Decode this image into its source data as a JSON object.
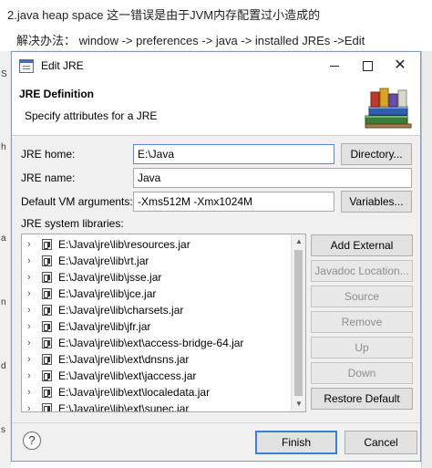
{
  "article": {
    "line1": "2.java heap space 这一错误是由于JVM内存配置过小造成的",
    "line2": "解决办法： window -> preferences -> java -> installed JREs ->Edit"
  },
  "background_strips": {
    "left_labels": [
      "S",
      "h",
      "a",
      "n",
      "d",
      "s"
    ]
  },
  "dialog": {
    "title": "Edit JRE",
    "header": {
      "title": "JRE Definition",
      "subtitle": "Specify attributes for a JRE"
    },
    "fields": {
      "jre_home_label": "JRE home:",
      "jre_home_value": "E:\\Java",
      "jre_name_label": "JRE name:",
      "jre_name_value": "Java",
      "vm_args_label": "Default VM arguments:",
      "vm_args_value": "-Xms512M -Xmx1024M",
      "libs_label": "JRE system libraries:"
    },
    "buttons": {
      "directory": "Directory...",
      "variables": "Variables...",
      "add_external_jars": "Add External JARs...",
      "javadoc_location": "Javadoc Location...",
      "source_attachment": "Source Attachment...",
      "remove": "Remove",
      "up": "Up",
      "down": "Down",
      "restore_default": "Restore Default",
      "finish": "Finish",
      "cancel": "Cancel"
    },
    "libraries": [
      "E:\\Java\\jre\\lib\\resources.jar",
      "E:\\Java\\jre\\lib\\rt.jar",
      "E:\\Java\\jre\\lib\\jsse.jar",
      "E:\\Java\\jre\\lib\\jce.jar",
      "E:\\Java\\jre\\lib\\charsets.jar",
      "E:\\Java\\jre\\lib\\jfr.jar",
      "E:\\Java\\jre\\lib\\ext\\access-bridge-64.jar",
      "E:\\Java\\jre\\lib\\ext\\dnsns.jar",
      "E:\\Java\\jre\\lib\\ext\\jaccess.jar",
      "E:\\Java\\jre\\lib\\ext\\localedata.jar",
      "E:\\Java\\jre\\lib\\ext\\sunec.jar"
    ]
  },
  "colors": {
    "dialog_bg": "#f0f0f0",
    "accent_border": "#3c7fd8",
    "disabled_text": "#8d8d8d"
  }
}
